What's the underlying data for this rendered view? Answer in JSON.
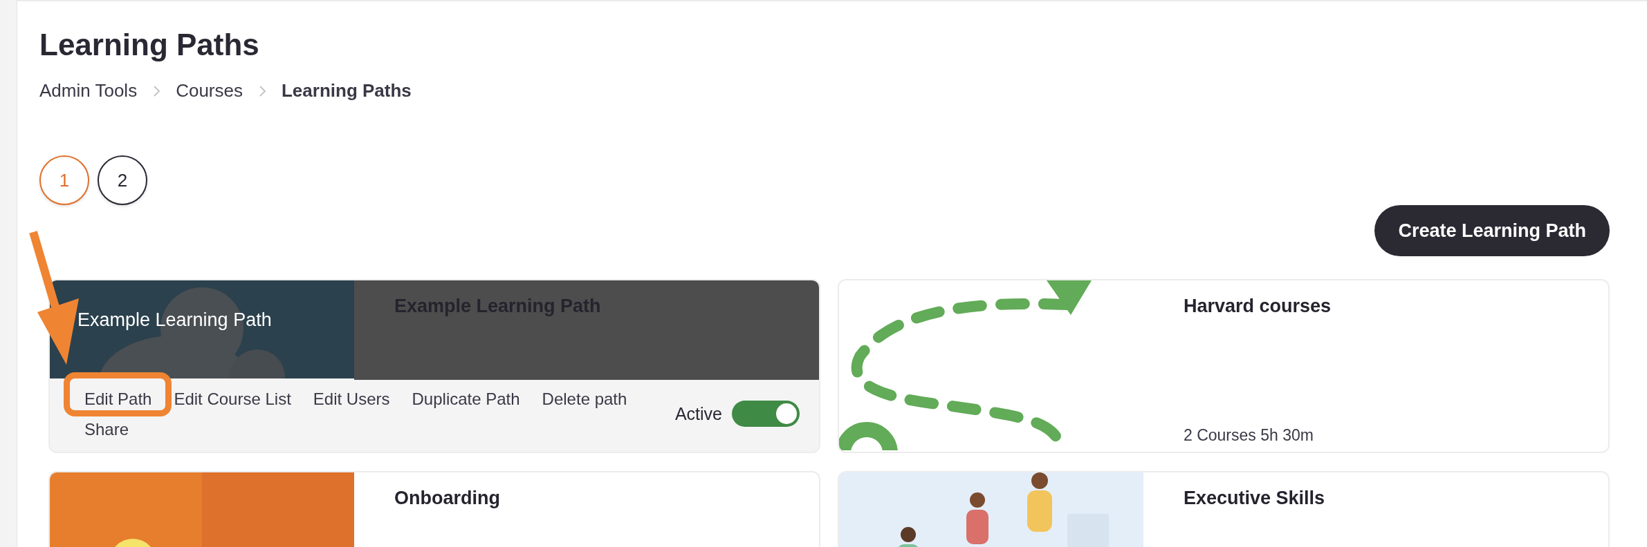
{
  "page": {
    "title": "Learning Paths"
  },
  "breadcrumb": [
    {
      "label": "Admin Tools",
      "current": false
    },
    {
      "label": "Courses",
      "current": false
    },
    {
      "label": "Learning Paths",
      "current": true
    }
  ],
  "pagination": [
    {
      "label": "1",
      "selected": true
    },
    {
      "label": "2",
      "selected": false
    }
  ],
  "create_button": "Create Learning Path",
  "cards": [
    {
      "title": "Example Learning Path",
      "hovered": true,
      "image_caption": "Example Learning Path",
      "actions": [
        "Edit Path",
        "Edit Course List",
        "Edit Users",
        "Duplicate Path",
        "Delete path",
        "Share"
      ],
      "toggle": {
        "label": "Active",
        "on": true
      }
    },
    {
      "title": "Harvard courses",
      "hovered": false,
      "meta": "2 Courses 5h 30m"
    },
    {
      "title": "Onboarding",
      "hovered": false
    },
    {
      "title": "Executive Skills",
      "hovered": false
    }
  ]
}
